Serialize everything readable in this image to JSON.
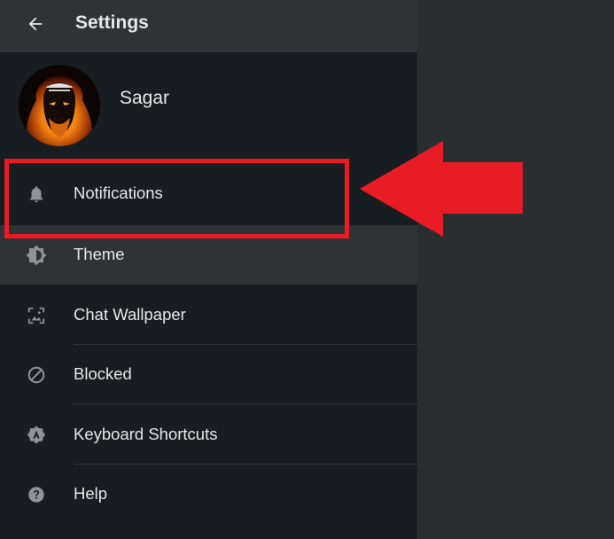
{
  "header": {
    "title": "Settings",
    "back_icon": "arrow-left-icon"
  },
  "profile": {
    "name": "Sagar",
    "avatar_icon": "profile-avatar"
  },
  "menu": {
    "items": [
      {
        "label": "Notifications",
        "icon": "bell-icon"
      },
      {
        "label": "Theme",
        "icon": "theme-icon"
      },
      {
        "label": "Chat Wallpaper",
        "icon": "wallpaper-icon"
      },
      {
        "label": "Blocked",
        "icon": "blocked-icon"
      },
      {
        "label": "Keyboard Shortcuts",
        "icon": "keyboard-shortcuts-icon"
      },
      {
        "label": "Help",
        "icon": "help-icon"
      }
    ]
  },
  "colors": {
    "sidebar_bg": "#181d21",
    "header_bg": "#2f3336",
    "active_item_bg": "#2f3336",
    "text_primary": "#e6e8e9",
    "icon_gray": "#8e9598",
    "annotation_red": "#e81c24"
  }
}
